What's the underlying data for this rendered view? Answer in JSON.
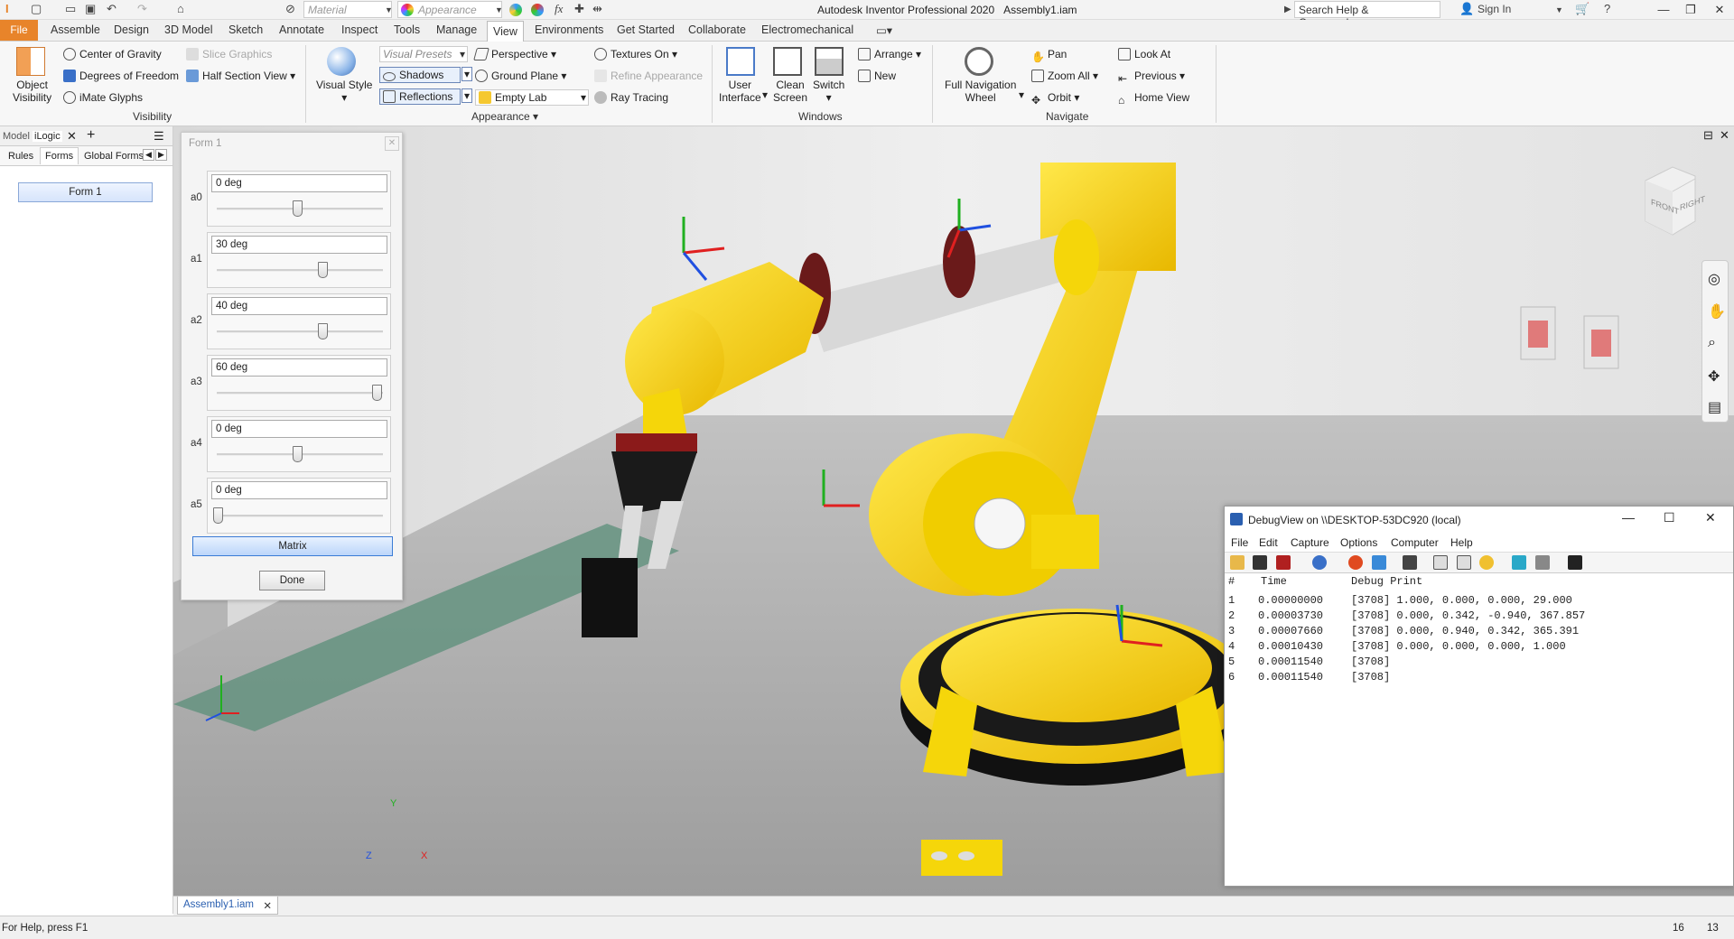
{
  "titlebar": {
    "app_title": "Autodesk Inventor Professional 2020",
    "document": "Assembly1.iam",
    "material_placeholder": "Material",
    "appearance_placeholder": "Appearance",
    "search_placeholder": "Search Help & Commands...",
    "sign_in": "Sign In",
    "fx_label": "fx"
  },
  "tabs": [
    "File",
    "Assemble",
    "Design",
    "3D Model",
    "Sketch",
    "Annotate",
    "Inspect",
    "Tools",
    "Manage",
    "View",
    "Environments",
    "Get Started",
    "Collaborate",
    "Electromechanical"
  ],
  "ribbon": {
    "object_visibility": "Object\nVisibility",
    "center_of_gravity": "Center of Gravity",
    "degrees_of_freedom": "Degrees of Freedom",
    "imate_glyphs": "iMate Glyphs",
    "slice_graphics": "Slice Graphics",
    "half_section_view": "Half Section View",
    "visibility_group": "Visibility",
    "visual_style": "Visual Style",
    "visual_presets": "Visual Presets",
    "shadows": "Shadows",
    "reflections": "Reflections",
    "perspective": "Perspective",
    "ground_plane": "Ground Plane",
    "empty_lab": "Empty Lab",
    "textures_on": "Textures On",
    "refine_appearance": "Refine Appearance",
    "ray_tracing": "Ray Tracing",
    "appearance_group": "Appearance",
    "user_interface": "User\nInterface",
    "clean_screen": "Clean\nScreen",
    "switch": "Switch",
    "arrange": "Arrange",
    "new": "New",
    "windows_group": "Windows",
    "full_navigation_wheel": "Full Navigation\nWheel",
    "pan": "Pan",
    "zoom_all": "Zoom All",
    "orbit": "Orbit",
    "look_at": "Look At",
    "previous": "Previous",
    "home_view": "Home View",
    "navigate_group": "Navigate"
  },
  "left_panel": {
    "tab_model": "Model",
    "tab_ilogic": "iLogic",
    "sub_tabs": [
      "Rules",
      "Forms",
      "Global Forms"
    ],
    "form_button": "Form 1"
  },
  "form": {
    "title": "Form 1",
    "params": [
      {
        "label": "a0",
        "value": "0 deg",
        "slider": 0.5
      },
      {
        "label": "a1",
        "value": "30 deg",
        "slider": 0.66
      },
      {
        "label": "a2",
        "value": "40 deg",
        "slider": 0.66
      },
      {
        "label": "a3",
        "value": "60 deg",
        "slider": 1.0
      },
      {
        "label": "a4",
        "value": "0 deg",
        "slider": 0.5
      },
      {
        "label": "a5",
        "value": "0 deg",
        "slider": 0.0
      }
    ],
    "matrix_button": "Matrix",
    "done_button": "Done"
  },
  "viewcube": {
    "front": "FRONT",
    "right": "RIGHT"
  },
  "axes_triad": {
    "x": "X",
    "y": "Y",
    "z": "Z"
  },
  "debugview": {
    "title": "DebugView on \\\\DESKTOP-53DC920 (local)",
    "menu": [
      "File",
      "Edit",
      "Capture",
      "Options",
      "Computer",
      "Help"
    ],
    "columns": [
      "#",
      "Time",
      "Debug Print"
    ],
    "rows": [
      {
        "n": "1",
        "time": "0.00000000",
        "text": "[3708] 1.000, 0.000, 0.000, 29.000"
      },
      {
        "n": "2",
        "time": "0.00003730",
        "text": "[3708] 0.000, 0.342, -0.940, 367.857"
      },
      {
        "n": "3",
        "time": "0.00007660",
        "text": "[3708] 0.000, 0.940, 0.342, 365.391"
      },
      {
        "n": "4",
        "time": "0.00010430",
        "text": "[3708] 0.000, 0.000, 0.000, 1.000"
      },
      {
        "n": "5",
        "time": "0.00011540",
        "text": "[3708]"
      },
      {
        "n": "6",
        "time": "0.00011540",
        "text": "[3708]"
      }
    ]
  },
  "document_tab": "Assembly1.iam",
  "status": {
    "help": "For Help, press F1",
    "count1": "16",
    "count2": "13"
  },
  "colors": {
    "file_tab": "#e8842a",
    "robot_yellow": "#f5d60a",
    "x_axis": "#e02020",
    "y_axis": "#20b020",
    "z_axis": "#2050e0"
  }
}
